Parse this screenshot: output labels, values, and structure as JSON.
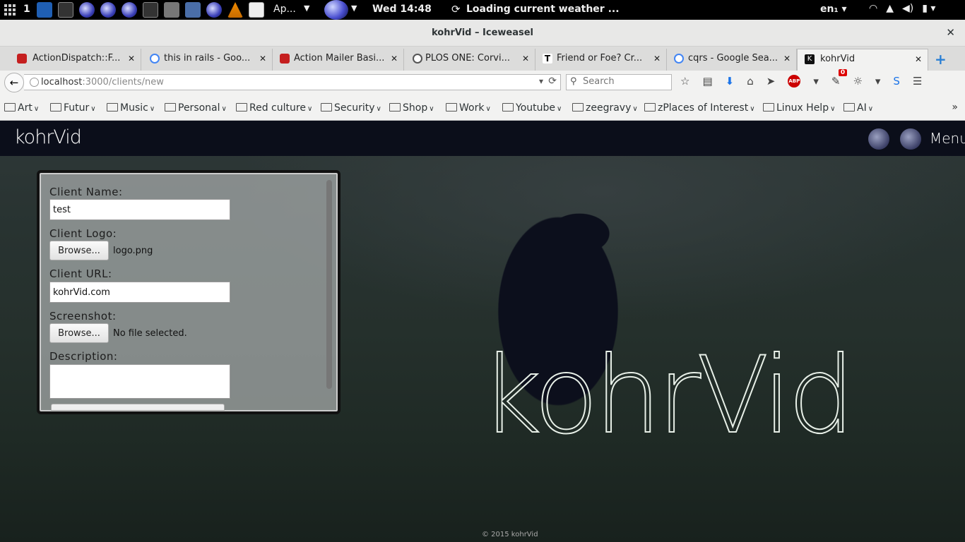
{
  "panel": {
    "workspace": "1",
    "apps_menu": "Ap...",
    "clock": "Wed 14:48",
    "weather": "Loading current weather ...",
    "lang": "en₁"
  },
  "window": {
    "title": "kohrVid – Iceweasel"
  },
  "tabs": [
    {
      "label": "ActionDispatch::F...",
      "icon": "rails-icon"
    },
    {
      "label": "this in rails - Goo...",
      "icon": "google-icon"
    },
    {
      "label": "Action Mailer Basi...",
      "icon": "rails-icon"
    },
    {
      "label": "PLOS ONE: Corvi...",
      "icon": "plos-icon"
    },
    {
      "label": "Friend or Foe? Cr...",
      "icon": "nyt-icon"
    },
    {
      "label": "cqrs - Google Sea...",
      "icon": "google-icon"
    },
    {
      "label": "kohrVid",
      "icon": "kohrvid-icon",
      "active": true
    }
  ],
  "navbar": {
    "url_host": "localhost",
    "url_rest": ":3000/clients/new",
    "search_placeholder": "Search",
    "notification_count": "0"
  },
  "bookmarks": [
    "Art",
    "Futur",
    "Music",
    "Personal",
    "Red culture",
    "Security",
    "Shop",
    "Work",
    "Youtube",
    "zeegravy",
    "zPlaces of Interest",
    "Linux Help",
    "AI"
  ],
  "site": {
    "brand": "kohrVid",
    "menu": "Menu",
    "hero_title": "kohrVid",
    "footer": "© 2015 kohrVid"
  },
  "form": {
    "client_name_label": "Client Name:",
    "client_name_value": "test",
    "client_logo_label": "Client Logo:",
    "browse_label": "Browse...",
    "logo_file": "logo.png",
    "client_url_label": "Client URL:",
    "client_url_value": "kohrVid.com",
    "screenshot_label": "Screenshot:",
    "screenshot_file": "No file selected.",
    "description_label": "Description:"
  }
}
